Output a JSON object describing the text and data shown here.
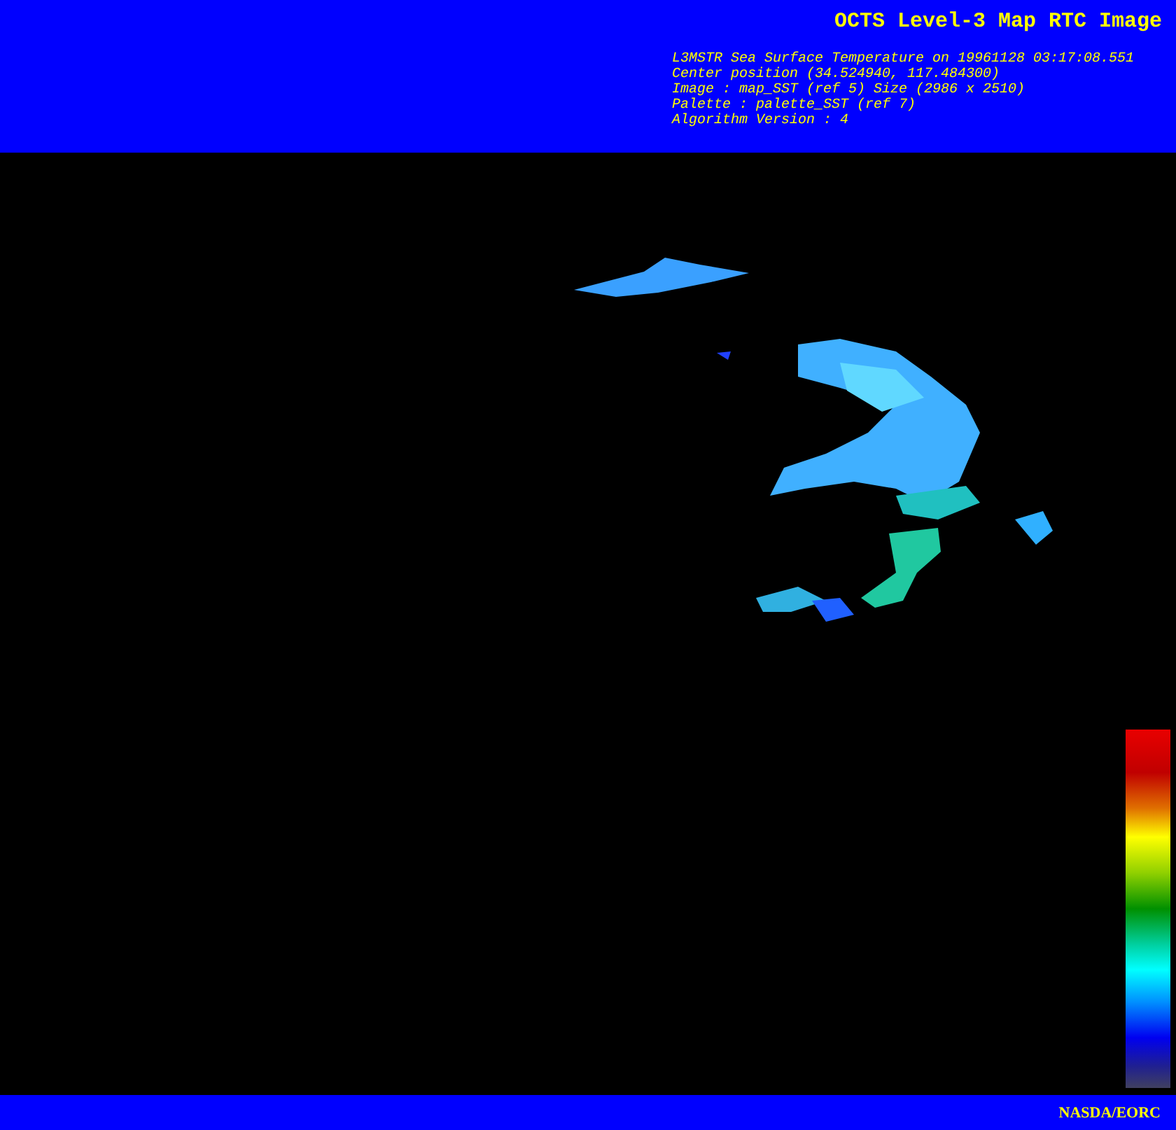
{
  "title": "OCTS Level-3 Map RTC Image",
  "info_lines": [
    "L3MSTR Sea Surface Temperature on 19961128 03:17:08.551",
    "Center position (34.524940, 117.484300)",
    "Image : map_SST (ref 5) Size (2986 x 2510)",
    "Palette : palette_SST (ref 7)",
    "Algorithm Version : 4"
  ],
  "footer": "NASDA/EORC"
}
